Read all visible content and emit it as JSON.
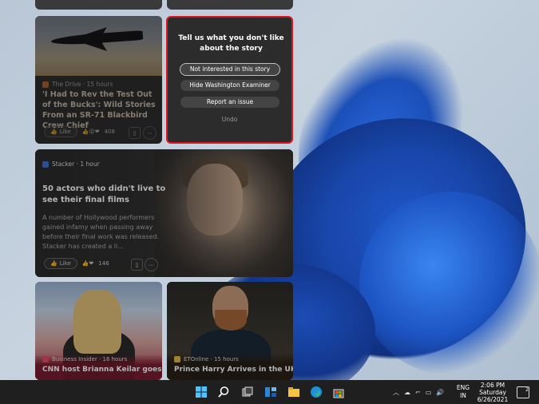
{
  "colors": {
    "highlight_border": "#e0161f",
    "taskbar": "#1f1f1f",
    "dialog_bg": "#2c2c2c"
  },
  "cards": {
    "sr71": {
      "source": "The Drive · 15 hours",
      "title": "'I Had to Rev the Test Out of the Bucks': Wild Stories From an SR-71 Blackbird Crew Chief",
      "like_label": "Like",
      "reactions": "408"
    },
    "actors": {
      "source": "Stacker · 1 hour",
      "title": "50 actors who didn't live to see their final films",
      "snippet": "A number of Hollywood performers gained infamy when passing away before their final work was released. Stacker has created a li...",
      "like_label": "Like",
      "reactions": "146"
    },
    "cnn": {
      "source": "Business Insider · 16 hours",
      "title": "CNN host Brianna Keilar goes off on"
    },
    "harry": {
      "source": "ETOnline · 15 hours",
      "title": "Prince Harry Arrives in the UK Ahead"
    }
  },
  "feedback_dialog": {
    "heading": "Tell us what you don't like about the story",
    "options": [
      "Not interested in this story",
      "Hide Washington Examiner",
      "Report an issue"
    ],
    "undo": "Undo"
  },
  "taskbar": {
    "icons": [
      "start-icon",
      "search-icon",
      "task-view-icon",
      "widgets-icon",
      "file-explorer-icon",
      "edge-icon",
      "store-icon"
    ],
    "language_line1": "ENG",
    "language_line2": "IN",
    "time": "2:06 PM",
    "day": "Saturday",
    "date": "6/26/2021",
    "notification_count": "2"
  }
}
